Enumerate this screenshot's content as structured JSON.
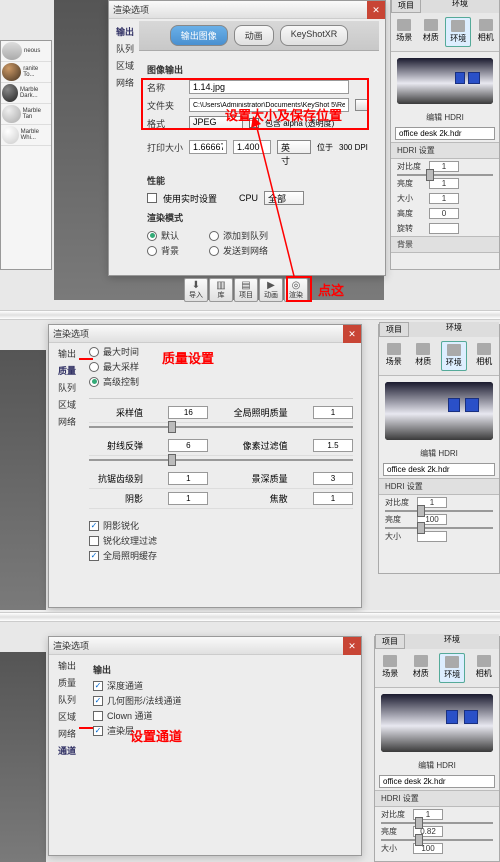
{
  "section1": {
    "dialog_title": "渲染选项",
    "tabs": [
      "输出图像",
      "动画",
      "KeyShotXR"
    ],
    "image_output_header": "图像输出",
    "name_label": "名称",
    "name_value": "1.14.jpg",
    "path_label": "文件夹",
    "path_value": "C:\\Users\\Administrator\\Documents\\KeyShot 5\\Renderings",
    "format_label": "格式",
    "format_value": "JPEG",
    "alpha_label": "包含 alpha (透明度)",
    "print_label": "打印大小",
    "print_w": "1.66667",
    "print_h": "1.400",
    "unit_label": "英寸",
    "dpi_label": "位于",
    "dpi_value": "300 DPI",
    "annotation": "设置大小及保存位置",
    "perf_header": "性能",
    "realtime_label": "使用实时设置",
    "cpu_label": "CPU",
    "cpu_value": "全部",
    "rendermode_header": "渲染模式",
    "mode1": "默认",
    "mode2": "背景",
    "mode3": "添加到队列",
    "mode4": "发送到网络",
    "toolbar": {
      "import": "导入",
      "lib": "库",
      "project": "项目",
      "anim": "动画",
      "render": "渲染"
    },
    "click_annot": "点这",
    "side_tabs": [
      "输出",
      "队列",
      "区域",
      "网络"
    ],
    "mat_items": [
      "neous",
      "ranite To...",
      "Marble Dark...",
      "Marble Tan",
      "Marble Whi..."
    ]
  },
  "section2": {
    "dialog_title": "渲染选项",
    "side_tabs": [
      "输出",
      "质量",
      "队列",
      "区域",
      "网络"
    ],
    "opts": [
      "最大时间",
      "最大采样",
      "高级控制"
    ],
    "annotation": "质量设置",
    "rows": [
      {
        "l1": "采样值",
        "v1": "16",
        "l2": "全局照明质量",
        "v2": "1"
      },
      {
        "l1": "射线反弹",
        "v1": "6",
        "l2": "像素过滤值",
        "v2": "1.5"
      },
      {
        "l1": "抗锯齿级别",
        "v1": "1",
        "l2": "景深质量",
        "v2": "3"
      },
      {
        "l1": "阴影",
        "v1": "1",
        "l2": "焦散",
        "v2": "1"
      }
    ],
    "checks": [
      "阴影锐化",
      "锐化纹理过滤",
      "全局照明缓存"
    ]
  },
  "section3": {
    "dialog_title": "渲染选项",
    "side_tabs": [
      "输出",
      "质量",
      "队列",
      "区域",
      "网络",
      "通道"
    ],
    "header": "输出",
    "checks": [
      "深度通道",
      "几何图形/法线通道",
      "Clown 通道",
      "渲染层"
    ],
    "annotation": "设置通道"
  },
  "env": {
    "panel_title": "环境",
    "top_tab": "项目",
    "tabs": [
      "场景",
      "材质",
      "环境",
      "相机"
    ],
    "hdri_label": "编辑 HDRI",
    "file": "office desk 2k.hdr",
    "settings_hdr": "HDRI 设置",
    "sliders": [
      {
        "label": "对比度",
        "val": "1"
      },
      {
        "label": "亮度",
        "val": "1"
      },
      {
        "label": "大小",
        "val": "1"
      },
      {
        "label": "高度",
        "val": "0"
      },
      {
        "label": "旋转",
        "val": ""
      }
    ],
    "sliders2": [
      {
        "label": "对比度",
        "val": "1"
      },
      {
        "label": "亮度",
        "val": "100"
      },
      {
        "label": "大小",
        "val": ""
      }
    ],
    "sliders3": [
      {
        "label": "对比度",
        "val": "1"
      },
      {
        "label": "亮度",
        "val": "0.82"
      },
      {
        "label": "大小",
        "val": "100"
      }
    ],
    "bg_hdr": "背景"
  }
}
